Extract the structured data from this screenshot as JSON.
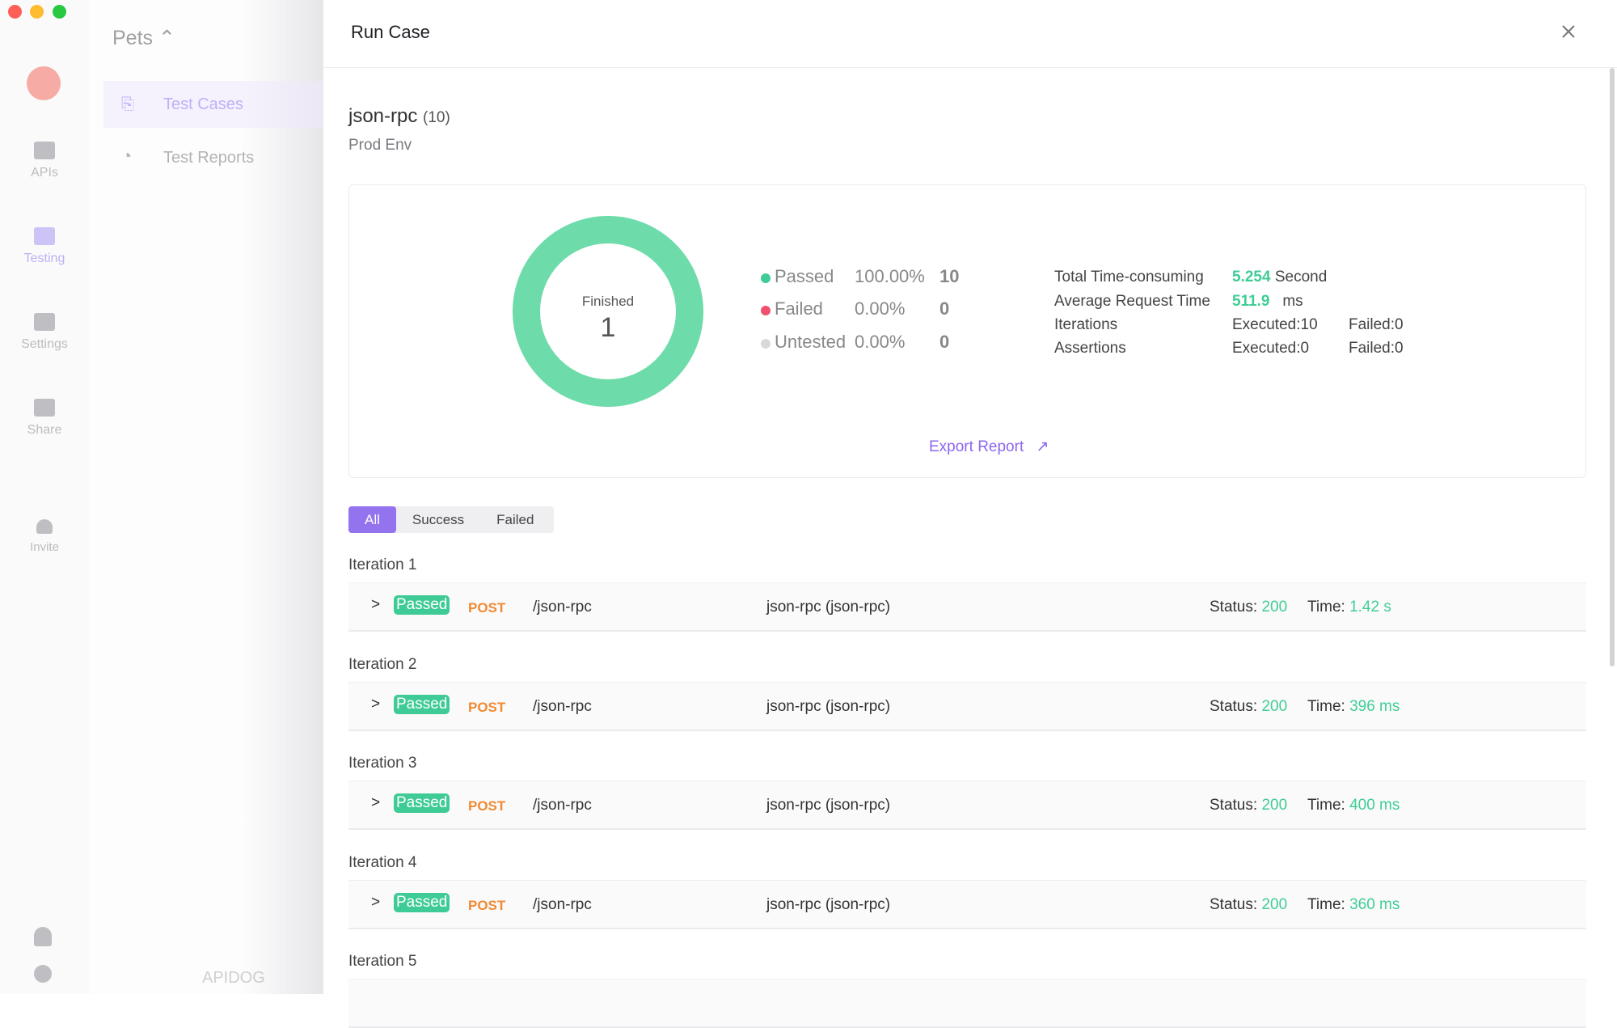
{
  "window": {
    "controls": [
      "close",
      "minimize",
      "maximize"
    ]
  },
  "rail": {
    "items": [
      {
        "label": "APIs",
        "icon": "api-icon"
      },
      {
        "label": "Testing",
        "icon": "testing-icon"
      },
      {
        "label": "Settings",
        "icon": "settings-icon"
      },
      {
        "label": "Share",
        "icon": "share-icon"
      },
      {
        "label": "Invite",
        "icon": "invite-icon"
      }
    ],
    "bottom": [
      "bell-icon",
      "gear-icon"
    ]
  },
  "nav": {
    "project": "Pets",
    "items": [
      {
        "label": "Test Cases",
        "active": true
      },
      {
        "label": "Test Reports"
      }
    ],
    "watermark": "APIDOG"
  },
  "drawer": {
    "title": "Run Case"
  },
  "case": {
    "name": "json-rpc",
    "count": "(10)",
    "env": "Prod Env"
  },
  "summary": {
    "donut_label": "Finished",
    "donut_value": "1",
    "passed_fraction": 1.0,
    "legend": [
      {
        "label": "Passed",
        "pct": "100.00%",
        "count": "10",
        "color": "#3fcd95"
      },
      {
        "label": "Failed",
        "pct": "0.00%",
        "count": "0",
        "color": "#f0506e"
      },
      {
        "label": "Untested",
        "pct": "0.00%",
        "count": "0",
        "color": "#d9d9d9"
      }
    ],
    "stats": {
      "total_label": "Total Time-consuming",
      "total_value": "5.254",
      "total_unit": "Second",
      "avg_label": "Average Request Time",
      "avg_value": "511.9",
      "avg_unit": "ms",
      "iter_label": "Iterations",
      "iter_exec": "Executed:10",
      "iter_failed": "Failed:0",
      "assert_label": "Assertions",
      "assert_exec": "Executed:0",
      "assert_failed": "Failed:0"
    },
    "export": "Export Report"
  },
  "filters": [
    "All",
    "Success",
    "Failed"
  ],
  "iterations": [
    {
      "label": "Iteration 1",
      "status": "Passed",
      "method": "POST",
      "path": "/json-rpc",
      "name": "json-rpc (json-rpc)",
      "status_label": "Status:",
      "code": "200",
      "time_label": "Time:",
      "time": "1.42 s"
    },
    {
      "label": "Iteration 2",
      "status": "Passed",
      "method": "POST",
      "path": "/json-rpc",
      "name": "json-rpc (json-rpc)",
      "status_label": "Status:",
      "code": "200",
      "time_label": "Time:",
      "time": "396 ms"
    },
    {
      "label": "Iteration 3",
      "status": "Passed",
      "method": "POST",
      "path": "/json-rpc",
      "name": "json-rpc (json-rpc)",
      "status_label": "Status:",
      "code": "200",
      "time_label": "Time:",
      "time": "400 ms"
    },
    {
      "label": "Iteration 4",
      "status": "Passed",
      "method": "POST",
      "path": "/json-rpc",
      "name": "json-rpc (json-rpc)",
      "status_label": "Status:",
      "code": "200",
      "time_label": "Time:",
      "time": "360 ms"
    },
    {
      "label": "Iteration 5"
    }
  ]
}
